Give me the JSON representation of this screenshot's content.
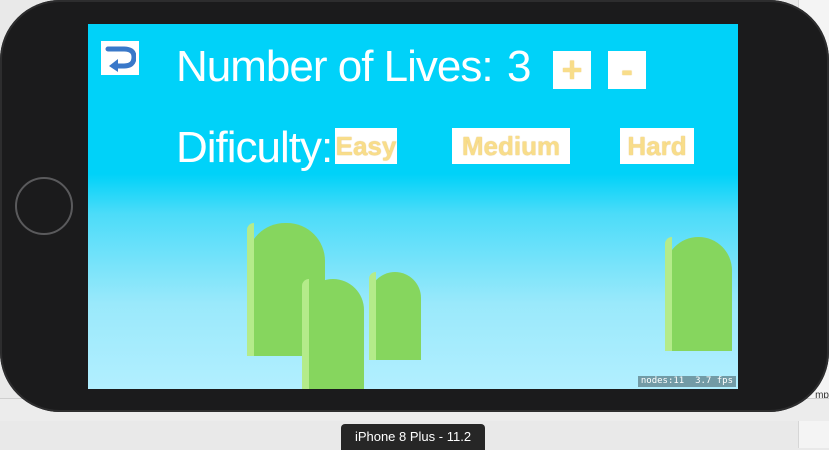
{
  "simulator": {
    "device_label": "iPhone 8 Plus - 11.2",
    "side_text": "mp"
  },
  "settings": {
    "lives_label": "Number of Lives:",
    "lives_value": "3",
    "increase_label": "+",
    "decrease_label": "-",
    "difficulty_label": "Dificulty:",
    "difficulties": [
      "Easy",
      "Medium",
      "Hard"
    ]
  },
  "debug": {
    "nodes": "nodes:11",
    "fps": "3.7 fps"
  },
  "colors": {
    "sky": "#00d2f9",
    "button_text": "#f8dd8a",
    "pipe": "#86d65e",
    "back_arrow": "#3a78c9"
  }
}
